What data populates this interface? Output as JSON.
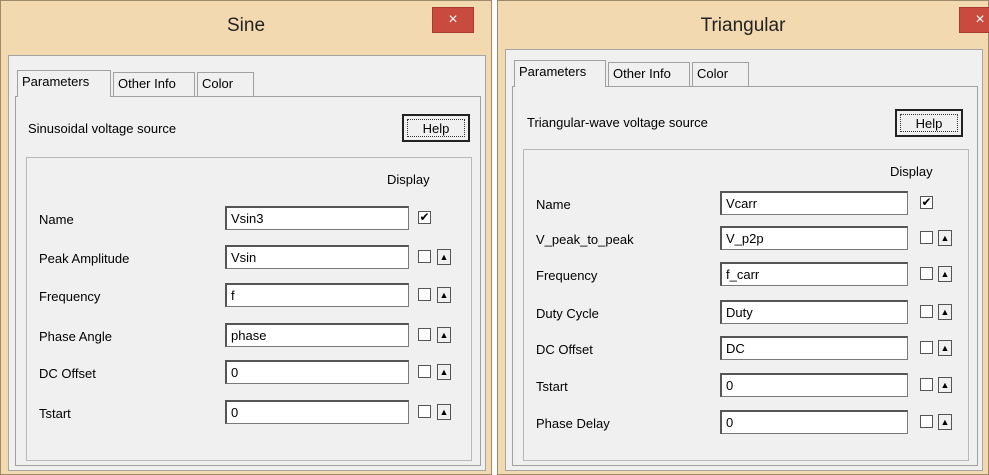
{
  "sine": {
    "title": "Sine",
    "close_icon": "×",
    "tabs": [
      "Parameters",
      "Other Info",
      "Color"
    ],
    "description": "Sinusoidal voltage source",
    "help_label": "Help",
    "display_header": "Display",
    "rows": [
      {
        "label": "Name",
        "value": "Vsin3",
        "display_checked": true
      },
      {
        "label": "Peak Amplitude",
        "value": "Vsin",
        "display_checked": false
      },
      {
        "label": "Frequency",
        "value": "f",
        "display_checked": false
      },
      {
        "label": "Phase Angle",
        "value": "phase",
        "display_checked": false
      },
      {
        "label": "DC Offset",
        "value": "0",
        "display_checked": false
      },
      {
        "label": "Tstart",
        "value": "0",
        "display_checked": false
      }
    ]
  },
  "tri": {
    "title": "Triangular",
    "close_icon": "×",
    "tabs": [
      "Parameters",
      "Other Info",
      "Color"
    ],
    "description": "Triangular-wave voltage source",
    "help_label": "Help",
    "display_header": "Display",
    "rows": [
      {
        "label": "Name",
        "value": "Vcarr",
        "display_checked": true
      },
      {
        "label": "V_peak_to_peak",
        "value": "V_p2p",
        "display_checked": false
      },
      {
        "label": "Frequency",
        "value": "f_carr",
        "display_checked": false
      },
      {
        "label": "Duty Cycle",
        "value": "Duty",
        "display_checked": false
      },
      {
        "label": "DC Offset",
        "value": "DC",
        "display_checked": false
      },
      {
        "label": "Tstart",
        "value": "0",
        "display_checked": false
      },
      {
        "label": "Phase Delay",
        "value": "0",
        "display_checked": false
      }
    ]
  },
  "glyphs": {
    "check": "✔",
    "dropdown": "▲"
  }
}
